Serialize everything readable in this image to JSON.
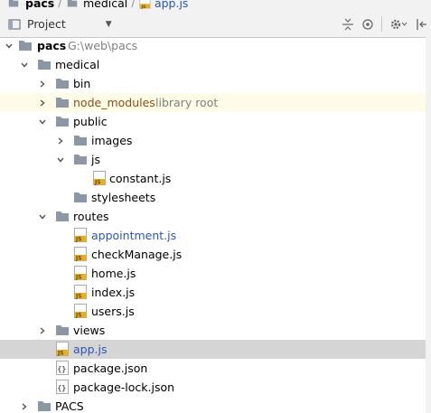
{
  "breadcrumb": {
    "project": "pacs",
    "folder": "medical",
    "file": "app.js",
    "separator": "/"
  },
  "toolbar": {
    "view_label": "Project",
    "icons": [
      "project-view-icon",
      "chevron-down-icon",
      "collapse-all-icon",
      "scroll-from-source-icon",
      "gear-icon",
      "hide-icon"
    ]
  },
  "tree": {
    "root_name": "pacs",
    "root_path": "G:\\web\\pacs",
    "medical": "medical",
    "bin": "bin",
    "node_modules": "node_modules",
    "library_root": "library root",
    "public": "public",
    "images": "images",
    "js": "js",
    "constant_js": "constant.js",
    "stylesheets": "stylesheets",
    "routes": "routes",
    "appointment_js": "appointment.js",
    "checkManage_js": "checkManage.js",
    "home_js": "home.js",
    "index_js": "index.js",
    "users_js": "users.js",
    "views": "views",
    "app_js": "app.js",
    "package_json": "package.json",
    "package_lock_json": "package-lock.json",
    "pacs_upper": "PACS"
  },
  "colors": {
    "folder": "#8c97a6",
    "selected_row": "#d5d5d5",
    "library_row": "#fefbe7",
    "modified_file": "#2a55b5",
    "library_text": "#8e4e16",
    "js_badge": "#e8b020"
  }
}
